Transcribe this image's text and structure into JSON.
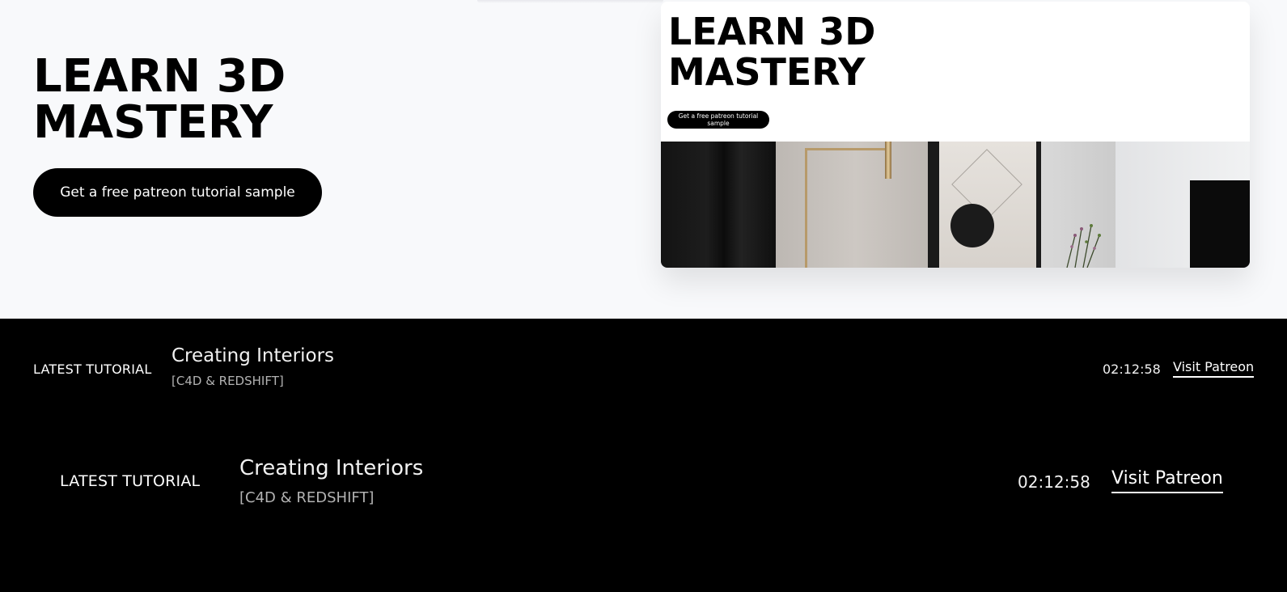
{
  "hero": {
    "title_line1": "LEARN 3D",
    "title_line2": "MASTERY",
    "cta_label": "Get a free patreon tutorial sample"
  },
  "preview": {
    "title_line1": "LEARN 3D",
    "title_line2": "MASTERY",
    "cta_label": "Get a free patreon tutorial sample"
  },
  "tutorial_primary": {
    "label": "LATEST TUTORIAL",
    "title": "Creating Interiors",
    "subtitle": "[C4D & REDSHIFT]",
    "duration": "02:12:58",
    "link_label": "Visit Patreon"
  },
  "tutorial_secondary": {
    "label": "LATEST TUTORIAL",
    "title": "Creating Interiors",
    "subtitle": "[C4D & REDSHIFT]",
    "duration": "02:12:58",
    "link_label": "Visit Patreon"
  },
  "colors": {
    "background": "#f8f9fb",
    "band": "#000000",
    "accent": "#000000",
    "text_light": "#ffffff",
    "subtitle": "#b3b3b3"
  }
}
